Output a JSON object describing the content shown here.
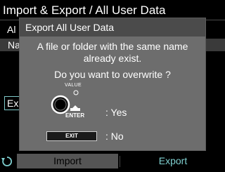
{
  "page": {
    "title": "Import & Export / All User Data",
    "row1_text": "Al",
    "row2_text": "Na",
    "left_button_text": "Ex"
  },
  "dialog": {
    "title": "Export All User Data",
    "message_line1": "A file or folder with the same name",
    "message_line2": "already exist.",
    "question": "Do you want to overwrite ?",
    "value_label": "VALUE",
    "enter_label": "ENTER",
    "yes_label": ": Yes",
    "exit_key_label": "EXIT",
    "no_label": ": No"
  },
  "bottom_bar": {
    "back_icon": "undo-arrow-icon",
    "import_label": "Import",
    "export_label": "Export"
  },
  "colors": {
    "accent": "#7fd0d0",
    "dialog_bg": "#6d6d6d",
    "dialog_header": "#4b4b4b"
  }
}
